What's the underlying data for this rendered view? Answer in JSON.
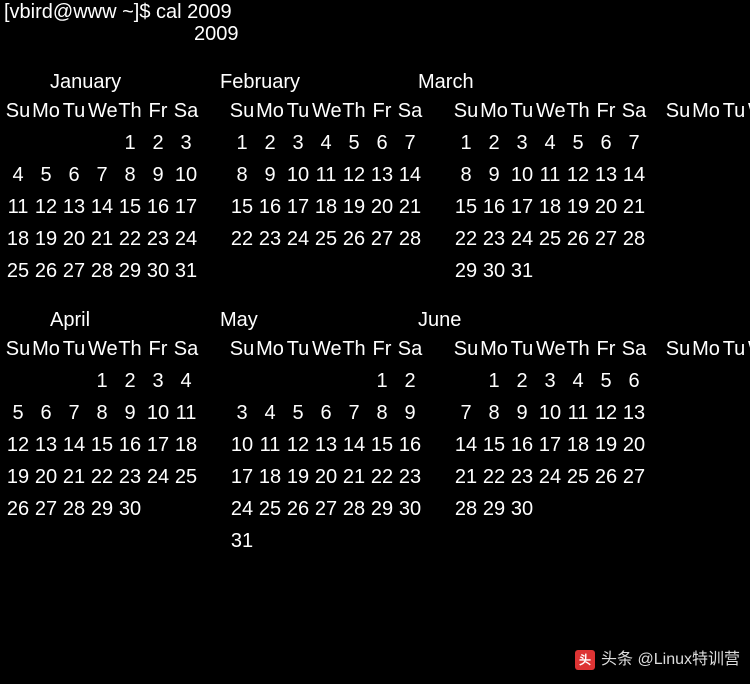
{
  "prompt": "[vbird@www ~]$ cal 2009",
  "year": "2009",
  "day_headers": [
    "Su",
    "Mo",
    "Tu",
    "We",
    "Th",
    "Fr",
    "Sa"
  ],
  "rows": [
    {
      "months": [
        "January",
        "February",
        "March"
      ],
      "weeks": [
        [
          [
            "",
            "",
            "",
            "",
            "1",
            "2",
            "3"
          ],
          [
            "1",
            "2",
            "3",
            "4",
            "5",
            "6",
            "7"
          ],
          [
            "1",
            "2",
            "3",
            "4",
            "5",
            "6",
            "7"
          ]
        ],
        [
          [
            "4",
            "5",
            "6",
            "7",
            "8",
            "9",
            "10"
          ],
          [
            "8",
            "9",
            "10",
            "11",
            "12",
            "13",
            "14"
          ],
          [
            "8",
            "9",
            "10",
            "11",
            "12",
            "13",
            "14"
          ]
        ],
        [
          [
            "11",
            "12",
            "13",
            "14",
            "15",
            "16",
            "17"
          ],
          [
            "15",
            "16",
            "17",
            "18",
            "19",
            "20",
            "21"
          ],
          [
            "15",
            "16",
            "17",
            "18",
            "19",
            "20",
            "21"
          ]
        ],
        [
          [
            "18",
            "19",
            "20",
            "21",
            "22",
            "23",
            "24"
          ],
          [
            "22",
            "23",
            "24",
            "25",
            "26",
            "27",
            "28"
          ],
          [
            "22",
            "23",
            "24",
            "25",
            "26",
            "27",
            "28"
          ]
        ],
        [
          [
            "25",
            "26",
            "27",
            "28",
            "29",
            "30",
            "31"
          ],
          [
            "",
            "",
            "",
            "",
            "",
            "",
            ""
          ],
          [
            "29",
            "30",
            "31",
            "",
            "",
            "",
            ""
          ]
        ]
      ]
    },
    {
      "months": [
        "April",
        "May",
        "June"
      ],
      "weeks": [
        [
          [
            "",
            "",
            "",
            "1",
            "2",
            "3",
            "4"
          ],
          [
            "",
            "",
            "",
            "",
            "",
            "1",
            "2"
          ],
          [
            "",
            "1",
            "2",
            "3",
            "4",
            "5",
            "6"
          ]
        ],
        [
          [
            "5",
            "6",
            "7",
            "8",
            "9",
            "10",
            "11"
          ],
          [
            "3",
            "4",
            "5",
            "6",
            "7",
            "8",
            "9"
          ],
          [
            "7",
            "8",
            "9",
            "10",
            "11",
            "12",
            "13"
          ]
        ],
        [
          [
            "12",
            "13",
            "14",
            "15",
            "16",
            "17",
            "18"
          ],
          [
            "10",
            "11",
            "12",
            "13",
            "14",
            "15",
            "16"
          ],
          [
            "14",
            "15",
            "16",
            "17",
            "18",
            "19",
            "20"
          ]
        ],
        [
          [
            "19",
            "20",
            "21",
            "22",
            "23",
            "24",
            "25"
          ],
          [
            "17",
            "18",
            "19",
            "20",
            "21",
            "22",
            "23"
          ],
          [
            "21",
            "22",
            "23",
            "24",
            "25",
            "26",
            "27"
          ]
        ],
        [
          [
            "26",
            "27",
            "28",
            "29",
            "30",
            "",
            ""
          ],
          [
            "24",
            "25",
            "26",
            "27",
            "28",
            "29",
            "30"
          ],
          [
            "28",
            "29",
            "30",
            "",
            "",
            "",
            ""
          ]
        ],
        [
          [
            "",
            "",
            "",
            "",
            "",
            "",
            ""
          ],
          [
            "31",
            "",
            "",
            "",
            "",
            "",
            ""
          ],
          [
            "",
            "",
            "",
            "",
            "",
            "",
            ""
          ]
        ]
      ]
    }
  ],
  "watermark": {
    "icon_text": "头",
    "text": "头条 @Linux特训营"
  }
}
